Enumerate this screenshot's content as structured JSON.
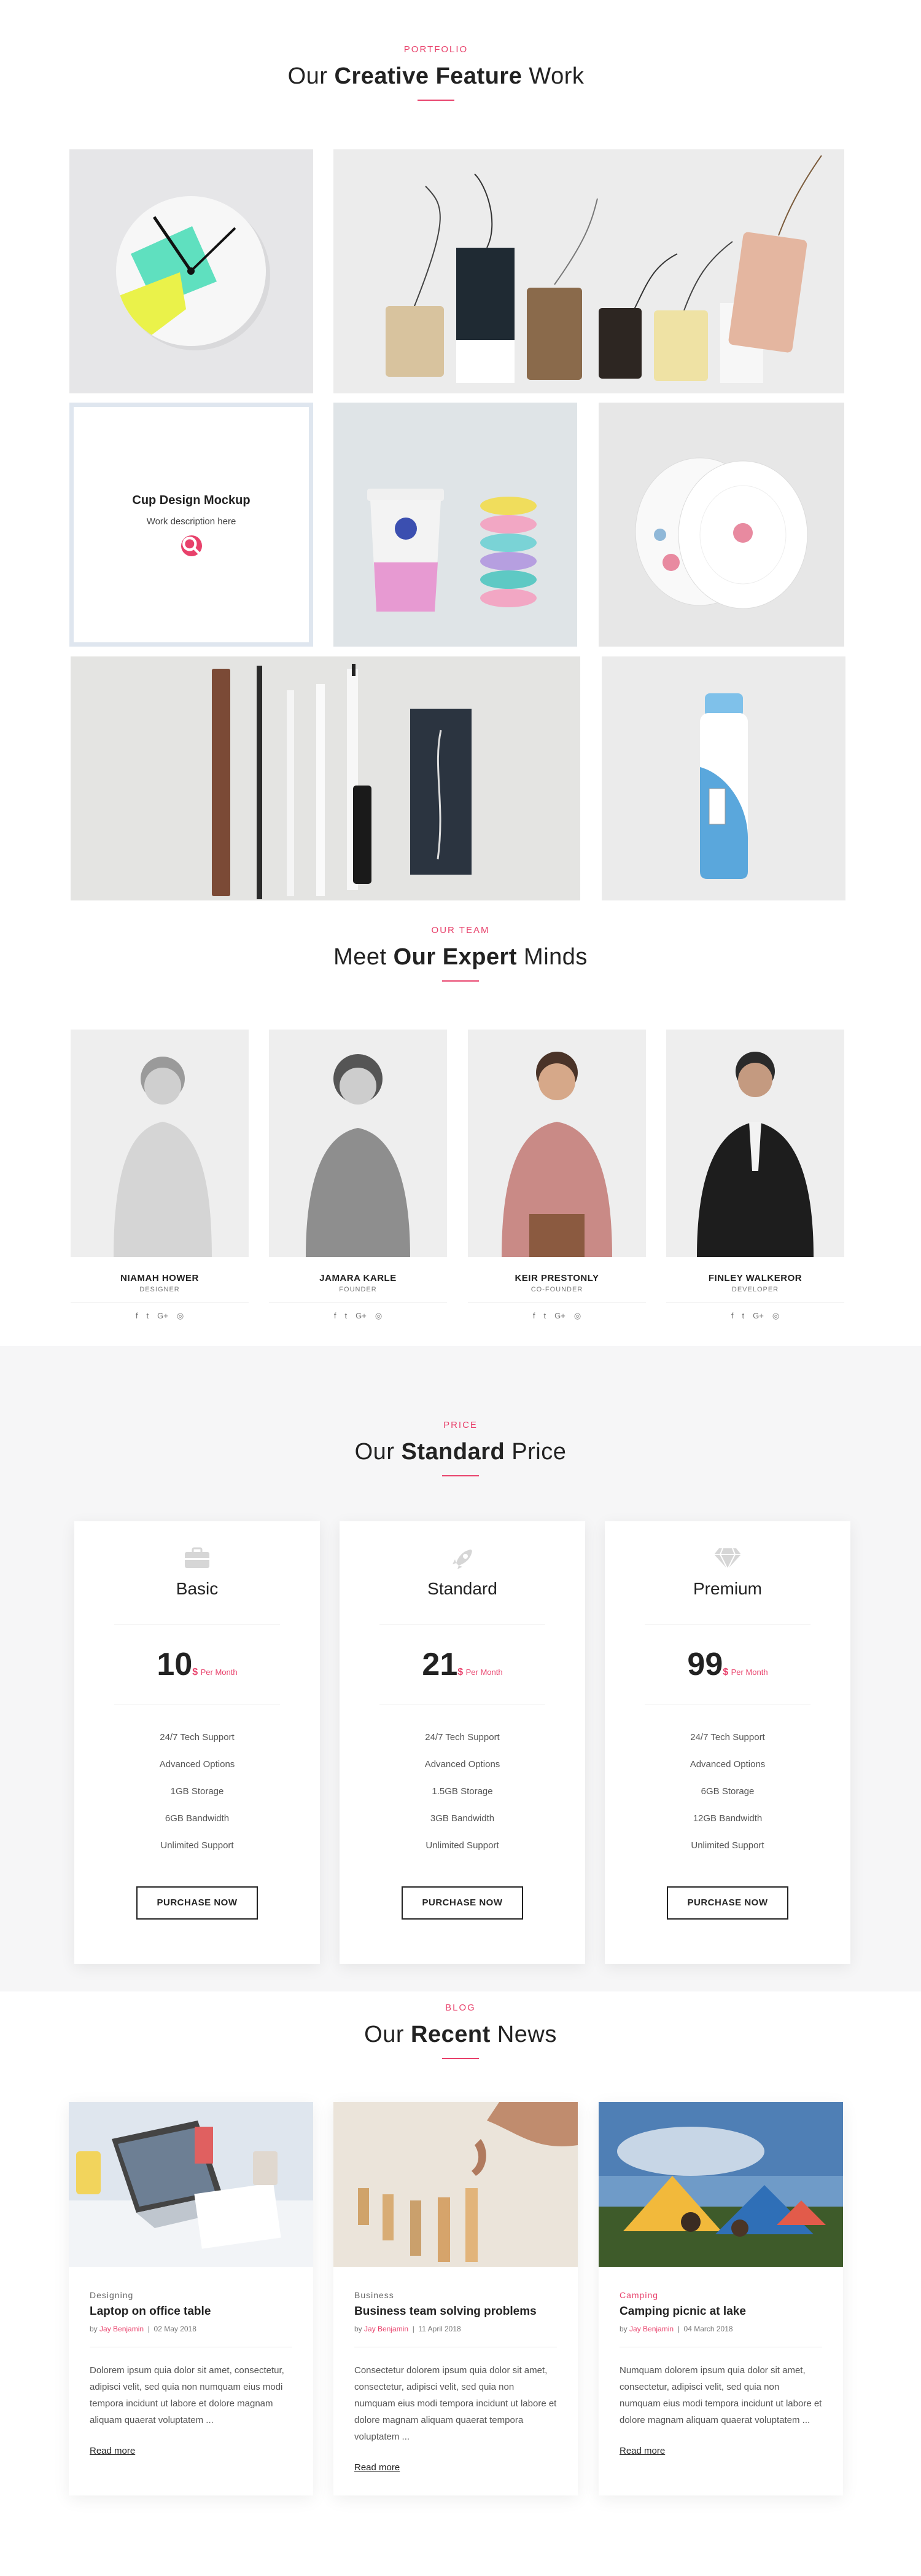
{
  "portfolio": {
    "eyebrow": "PORTFOLIO",
    "title_pre": "Our ",
    "title_bold": "Creative Feature",
    "title_post": " Work",
    "hover_title": "Cup Design Mockup",
    "hover_desc": "Work description here"
  },
  "team": {
    "eyebrow": "OUR TEAM",
    "title_pre": "Meet ",
    "title_bold": "Our Expert",
    "title_post": " Minds",
    "members": [
      {
        "name": "NIAMAH HOWER",
        "role": "DESIGNER"
      },
      {
        "name": "JAMARA KARLE",
        "role": "FOUNDER"
      },
      {
        "name": "KEIR PRESTONLY",
        "role": "CO-FOUNDER"
      },
      {
        "name": "FINLEY WALKEROR",
        "role": "DEVELOPER"
      }
    ],
    "socials": [
      "f",
      "t",
      "G+",
      "◎"
    ]
  },
  "price": {
    "eyebrow": "PRICE",
    "title_pre": "Our ",
    "title_bold": "Standard",
    "title_post": " Price",
    "currency": "$",
    "per": "Per Month",
    "button": "PURCHASE NOW",
    "plans": [
      {
        "name": "Basic",
        "icon": "briefcase-icon",
        "price": "10",
        "features": [
          "24/7 Tech Support",
          "Advanced Options",
          "1GB Storage",
          "6GB Bandwidth",
          "Unlimited Support"
        ]
      },
      {
        "name": "Standard",
        "icon": "rocket-icon",
        "price": "21",
        "features": [
          "24/7 Tech Support",
          "Advanced Options",
          "1.5GB Storage",
          "3GB Bandwidth",
          "Unlimited Support"
        ]
      },
      {
        "name": "Premium",
        "icon": "diamond-icon",
        "price": "99",
        "features": [
          "24/7 Tech Support",
          "Advanced Options",
          "6GB Storage",
          "12GB Bandwidth",
          "Unlimited Support"
        ]
      }
    ]
  },
  "blog": {
    "eyebrow": "BLOG",
    "title_pre": "Our ",
    "title_bold": "Recent",
    "title_post": " News",
    "read_more": "Read more",
    "by": "by ",
    "posts": [
      {
        "category": "Designing",
        "title": "Laptop on office table",
        "author": "Jay Benjamin",
        "date": "02 May 2018",
        "excerpt": "Dolorem ipsum quia dolor sit amet, consectetur, adipisci velit, sed quia non numquam eius modi tempora incidunt ut labore et dolore magnam aliquam quaerat voluptatem ..."
      },
      {
        "category": "Business",
        "title": "Business team solving problems",
        "author": "Jay Benjamin",
        "date": "11 April 2018",
        "excerpt": "Consectetur dolorem ipsum quia dolor sit amet, consectetur, adipisci velit, sed quia non numquam eius modi tempora incidunt ut labore et dolore magnam aliquam quaerat tempora voluptatem ..."
      },
      {
        "category": "Camping",
        "title": "Camping picnic at lake",
        "author": "Jay Benjamin",
        "date": "04 March 2018",
        "excerpt": "Numquam dolorem ipsum quia dolor sit amet, consectetur, adipisci velit, sed quia non numquam eius modi tempora incidunt ut labore et dolore magnam aliquam quaerat voluptatem ..."
      }
    ]
  },
  "colors": {
    "accent": "#e8416b",
    "text": "#222222",
    "muted": "#777777",
    "price_bg": "#f6f6f7"
  }
}
